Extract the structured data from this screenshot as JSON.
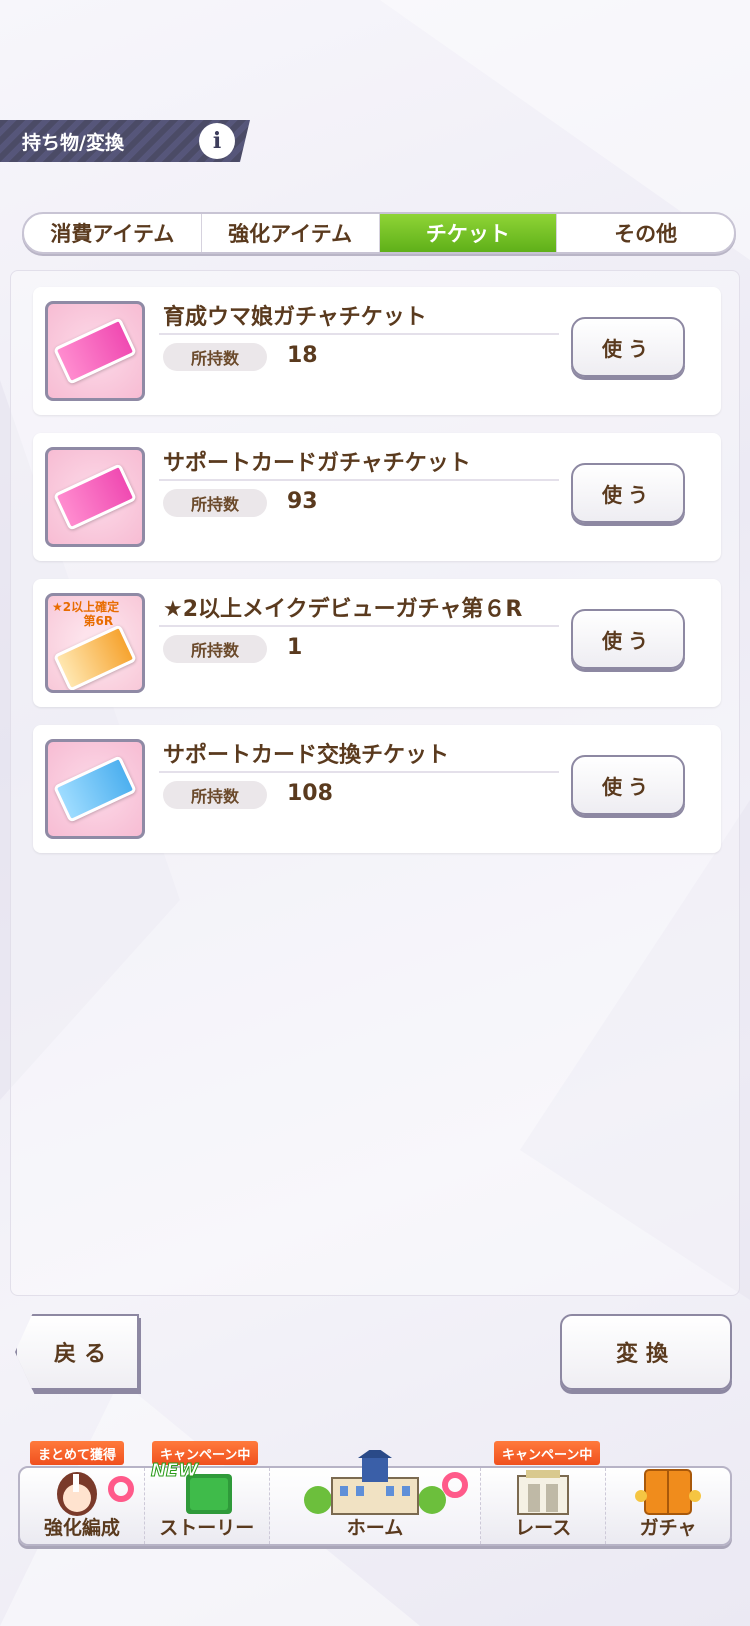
{
  "header": {
    "title": "持ち物/変換",
    "info_icon": "i"
  },
  "tabs": [
    {
      "label": "消費アイテム",
      "active": false
    },
    {
      "label": "強化アイテム",
      "active": false
    },
    {
      "label": "チケット",
      "active": true
    },
    {
      "label": "その他",
      "active": false
    }
  ],
  "items": [
    {
      "name": "育成ウマ娘ガチャチケット",
      "owned_label": "所持数",
      "owned": "18",
      "use_label": "使う",
      "icon": "pink-ticket-icon"
    },
    {
      "name": "サポートカードガチャチケット",
      "owned_label": "所持数",
      "owned": "93",
      "use_label": "使う",
      "icon": "pink-ticket-icon"
    },
    {
      "name": "★2以上メイクデビューガチャ第６R",
      "owned_label": "所持数",
      "owned": "1",
      "use_label": "使う",
      "icon": "orange-ticket-icon",
      "icon_badge_line1": "★2以上確定",
      "icon_badge_line2": "第6R"
    },
    {
      "name": "サポートカード交換チケット",
      "owned_label": "所持数",
      "owned": "108",
      "use_label": "使う",
      "icon": "blue-ticket-icon"
    }
  ],
  "buttons": {
    "back": "戻る",
    "convert": "変換"
  },
  "nav": {
    "items": [
      {
        "label": "強化編成",
        "tag": "まとめて獲得"
      },
      {
        "label": "ストーリー",
        "tag": "キャンペーン中",
        "new_badge": "NEW"
      },
      {
        "label": "ホーム"
      },
      {
        "label": "レース",
        "tag": "キャンペーン中"
      },
      {
        "label": "ガチャ"
      }
    ]
  },
  "colors": {
    "accent_green": "#6cc21f",
    "text_brown": "#5a3a1e",
    "tag_orange": "#f0501e"
  }
}
